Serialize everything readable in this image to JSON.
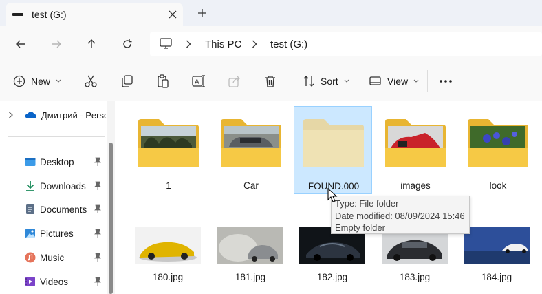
{
  "window": {
    "tab_title": "test (G:)",
    "new_tab_label": "+"
  },
  "address": {
    "crumbs": [
      "This PC",
      "test (G:)"
    ]
  },
  "toolbar": {
    "new_label": "New",
    "sort_label": "Sort",
    "view_label": "View"
  },
  "sidebar": {
    "onedrive_label": "Дмитрий - Perso",
    "items": [
      {
        "label": "Desktop",
        "icon": "desktop-icon"
      },
      {
        "label": "Downloads",
        "icon": "downloads-icon"
      },
      {
        "label": "Documents",
        "icon": "documents-icon"
      },
      {
        "label": "Pictures",
        "icon": "pictures-icon"
      },
      {
        "label": "Music",
        "icon": "music-icon"
      },
      {
        "label": "Videos",
        "icon": "videos-icon"
      }
    ]
  },
  "folders": [
    {
      "name": "1"
    },
    {
      "name": "Car"
    },
    {
      "name": "FOUND.000",
      "selected": true
    },
    {
      "name": "images"
    },
    {
      "name": "look"
    }
  ],
  "images": [
    {
      "name": "180.jpg"
    },
    {
      "name": "181.jpg"
    },
    {
      "name": "182.jpg"
    },
    {
      "name": "183.jpg"
    },
    {
      "name": "184.jpg"
    }
  ],
  "tooltip": {
    "type": "Type: File folder",
    "date": "Date modified: 08/09/2024 15:46",
    "status": "Empty folder"
  },
  "colors": {
    "folder": "#f6c945",
    "folder_back": "#e8b532",
    "selection": "#cce8ff",
    "accent": "#0067c0"
  }
}
